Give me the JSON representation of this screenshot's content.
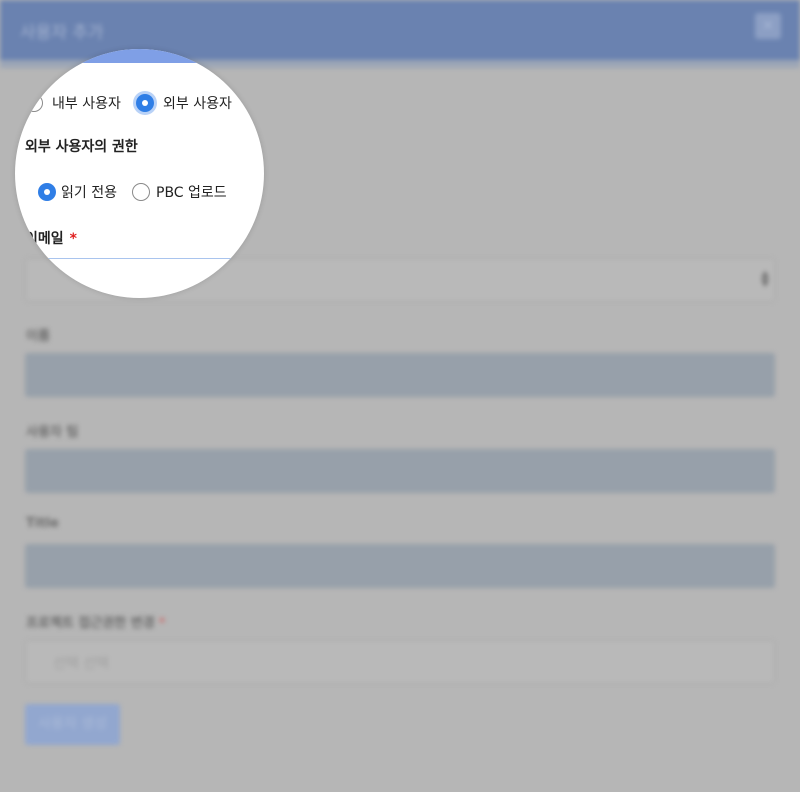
{
  "dialog": {
    "title": "사용자 추가",
    "close_icon": "close-icon"
  },
  "user_type": {
    "options": [
      {
        "label": "내부 사용자",
        "selected": false
      },
      {
        "label": "외부 사용자",
        "selected": true
      }
    ]
  },
  "permissions": {
    "heading": "외부 사용자의 권한",
    "options": [
      {
        "label": "읽기 전용",
        "selected": true
      },
      {
        "label": "PBC 업로드",
        "selected": false
      }
    ]
  },
  "fields": {
    "email_label": "이메일",
    "required_mark": "*",
    "name_label": "이름",
    "company_label": "사용자 팀",
    "title_label": "Title",
    "project_label": "프로젝트 접근권한 변경",
    "project_placeholder": "선택 선택"
  },
  "actions": {
    "submit_label": "사용자 생성"
  },
  "colors": {
    "header": "#6a82b0",
    "accent": "#2f7ee6",
    "required": "#e02020"
  }
}
